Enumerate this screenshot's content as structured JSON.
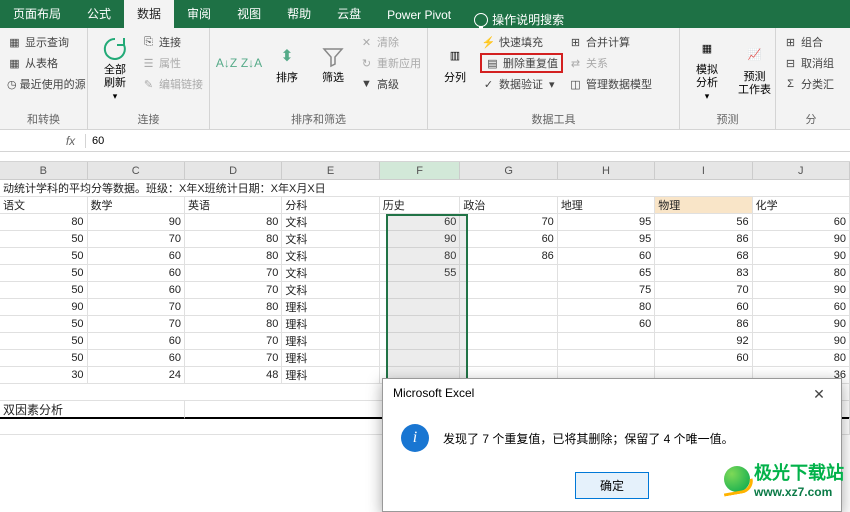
{
  "tabs": [
    "页面布局",
    "公式",
    "数据",
    "审阅",
    "视图",
    "帮助",
    "云盘",
    "Power Pivot"
  ],
  "active_tab": "数据",
  "tell_me": "操作说明搜索",
  "ribbon": {
    "g1": {
      "items": [
        "显示查询",
        "从表格",
        "最近使用的源"
      ],
      "label": "和转换"
    },
    "g2": {
      "big": "全部刷新",
      "items": [
        "连接",
        "属性",
        "编辑链接"
      ],
      "label": "连接"
    },
    "g3": {
      "big": "排序",
      "big2": "筛选",
      "items": [
        "清除",
        "重新应用",
        "高级"
      ],
      "label": "排序和筛选"
    },
    "g4": {
      "big": "分列",
      "items": [
        "快速填充",
        "删除重复值",
        "数据验证"
      ],
      "items2": [
        "合并计算",
        "关系",
        "管理数据模型"
      ],
      "label": "数据工具"
    },
    "g5": {
      "big1": "模拟分析",
      "big2": "预测\n工作表",
      "label": "预测"
    },
    "g6": {
      "items": [
        "组合",
        "取消组",
        "分类汇"
      ],
      "label": "分"
    }
  },
  "fx_value": "60",
  "col_headers": [
    "B",
    "C",
    "D",
    "E",
    "F",
    "G",
    "H",
    "I",
    "J"
  ],
  "title_row": "动统计学科的平均分等数据。班级：X年X班统计日期：X年X月X日",
  "headers": [
    "语文",
    "数学",
    "英语",
    "分科",
    "历史",
    "政治",
    "地理",
    "物理",
    "化学"
  ],
  "data_rows": [
    [
      "80",
      "90",
      "80",
      "文科",
      "60",
      "70",
      "95",
      "56",
      "60"
    ],
    [
      "50",
      "70",
      "80",
      "文科",
      "90",
      "60",
      "95",
      "86",
      "90"
    ],
    [
      "50",
      "60",
      "80",
      "文科",
      "80",
      "86",
      "60",
      "68",
      "90"
    ],
    [
      "50",
      "60",
      "70",
      "文科",
      "55",
      "",
      "65",
      "83",
      "80"
    ],
    [
      "50",
      "60",
      "70",
      "文科",
      "",
      "",
      "75",
      "70",
      "90"
    ],
    [
      "90",
      "70",
      "80",
      "理科",
      "",
      "",
      "80",
      "60",
      "60"
    ],
    [
      "50",
      "70",
      "80",
      "理科",
      "",
      "",
      "60",
      "86",
      "90"
    ],
    [
      "50",
      "60",
      "70",
      "理科",
      "",
      "",
      "",
      "92",
      "90"
    ],
    [
      "50",
      "60",
      "70",
      "理科",
      "",
      "",
      "",
      "60",
      "80"
    ],
    [
      "30",
      "24",
      "48",
      "理科",
      "",
      "",
      "",
      "",
      "36"
    ]
  ],
  "section_label": "双因素分析",
  "dialog": {
    "title": "Microsoft Excel",
    "message": "发现了 7 个重复值，已将其删除；保留了 4 个唯一值。",
    "ok": "确定"
  },
  "watermark": {
    "brand": "极光下载站",
    "url": "www.xz7.com"
  }
}
